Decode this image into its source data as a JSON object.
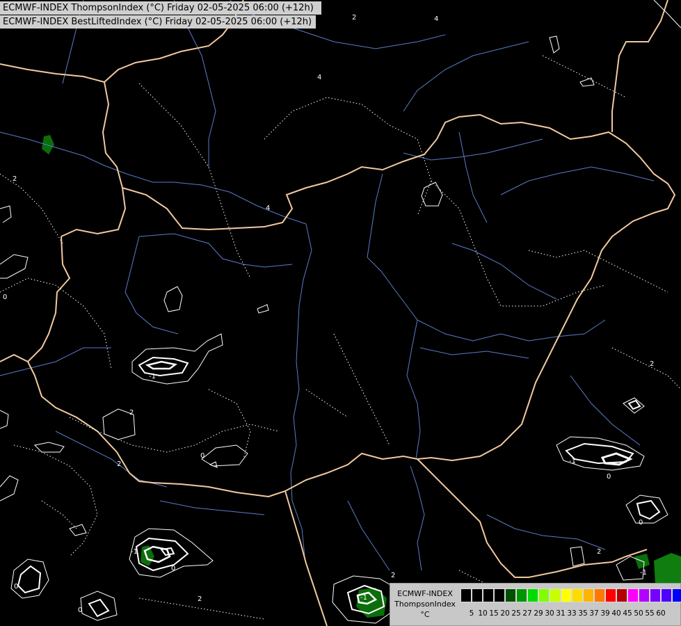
{
  "titles": {
    "line1": "ECMWF-INDEX ThompsonIndex (°C) Friday 02-05-2025 06:00 (+12h)",
    "line2": "ECMWF-INDEX BestLiftedIndex (°C) Friday 02-05-2025 06:00 (+12h)"
  },
  "legend": {
    "line1": "ECMWF-INDEX",
    "line2": "ThompsonIndex",
    "line3": "°C",
    "colors": [
      "#000000",
      "#000000",
      "#000000",
      "#000000",
      "#005000",
      "#009600",
      "#00dc00",
      "#80ff00",
      "#c8ff00",
      "#ffff00",
      "#ffdc00",
      "#ffb400",
      "#ff7800",
      "#ff0000",
      "#b40000",
      "#ff00ff",
      "#b400ff",
      "#7800ff",
      "#4b00ff",
      "#0000ff"
    ],
    "ticks": [
      "5",
      "10",
      "15",
      "20",
      "25",
      "27",
      "29",
      "30",
      "31",
      "33",
      "35",
      "37",
      "39",
      "40",
      "45",
      "50",
      "55",
      "60"
    ]
  },
  "contour_labels": [
    "4",
    "4",
    "4",
    "2",
    "0",
    "2",
    "-1",
    "0",
    "2",
    "2",
    "0",
    "2",
    "-1",
    "0",
    "0",
    "2",
    "2",
    "-1",
    "0",
    "-1",
    "0",
    "-1",
    "2"
  ],
  "colors": {
    "background": "#000000",
    "border": "#f2c9a0",
    "river": "#5a7cc8",
    "contour": "#ffffff",
    "fill_dark_green": "#0b6e0b"
  }
}
